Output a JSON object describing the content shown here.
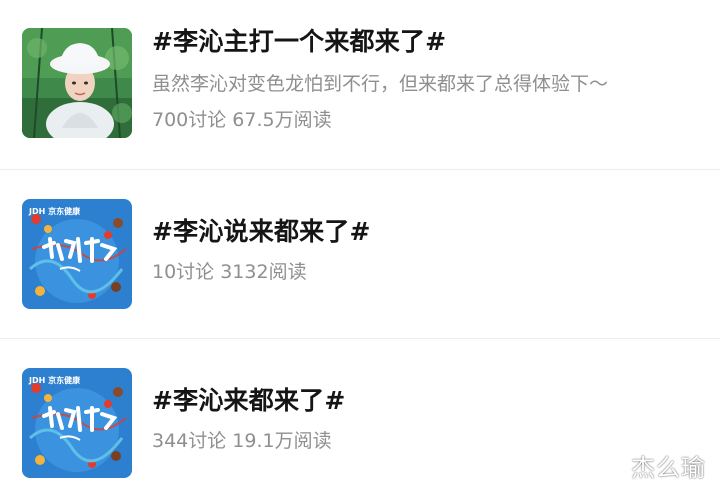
{
  "topics": [
    {
      "title": "#李沁主打一个来都来了#",
      "description": "虽然李沁对变色龙怕到不行，但来都来了总得体验下～",
      "stats": "700讨论 67.5万阅读",
      "thumbnail": "woman-in-white-bucket-hat-photo"
    },
    {
      "title": "#李沁说来都来了#",
      "stats": "10讨论 3132阅读",
      "thumbnail": "show-logo-poster",
      "thumb_text": "JDH 京东健康"
    },
    {
      "title": "#李沁来都来了#",
      "stats": "344讨论 19.1万阅读",
      "thumbnail": "show-logo-poster",
      "thumb_text": "JDH 京东健康"
    }
  ],
  "watermark": "杰么瑜",
  "colors": {
    "title": "#151515",
    "meta": "#8f8f8f",
    "divider": "#ececec",
    "poster_blue": "#2d7fd0",
    "poster_red": "#e23c2c"
  }
}
